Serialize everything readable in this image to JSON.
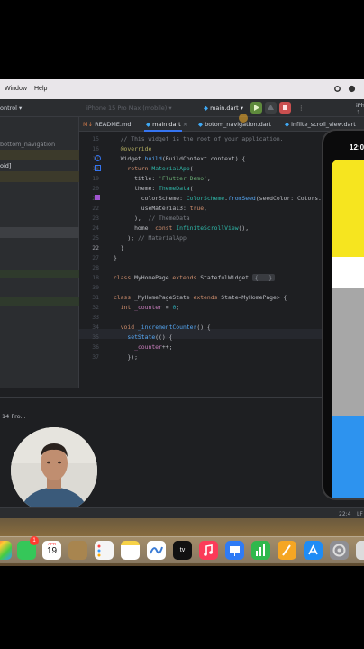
{
  "menubar": {
    "window_label": "Window",
    "help_label": "Help"
  },
  "toolbar": {
    "vcs_label": "ontrol ▾",
    "device_label": "iPhone 15 Pro Max (mobile) ▾",
    "run_config_label": "main.dart ▾",
    "device_short": "iPh",
    "device_short2": "1"
  },
  "tabs": [
    {
      "label": "README.md",
      "active": false
    },
    {
      "label": "main.dart",
      "active": true
    },
    {
      "label": "botom_navigation.dart",
      "active": false
    },
    {
      "label": "infilte_scroll_view.dart",
      "active": false
    }
  ],
  "project_panel": {
    "item1": "bottom_navigation",
    "item2": "oid]"
  },
  "editor": {
    "lines": [
      {
        "n": "15",
        "text": "// This widget is the root of your application."
      },
      {
        "n": "16",
        "text": "@override"
      },
      {
        "n": "17",
        "text": "Widget build(BuildContext context) {"
      },
      {
        "n": "18",
        "text": "return MaterialApp("
      },
      {
        "n": "19",
        "text": "title: 'Flutter Demo',"
      },
      {
        "n": "20",
        "text": "theme: ThemeData("
      },
      {
        "n": "21",
        "text": "colorScheme: ColorScheme.fromSeed(seedColor: Colors.d"
      },
      {
        "n": "22",
        "text": "useMaterial3: true,"
      },
      {
        "n": "23",
        "text": "),  // ThemeData"
      },
      {
        "n": "24",
        "text": "home: const InfiniteScrollView(),"
      },
      {
        "n": "25",
        "text": "); // MaterialApp"
      },
      {
        "n": "22",
        "text": "}"
      },
      {
        "n": "27",
        "text": "}"
      },
      {
        "n": "28",
        "text": ""
      },
      {
        "n": "18",
        "text": "class MyHomePage extends StatefulWidget {...}"
      },
      {
        "n": "30",
        "text": ""
      },
      {
        "n": "31",
        "text": "class _MyHomePageState extends State<MyHomePage> {"
      },
      {
        "n": "32",
        "text": "int _counter = 0;"
      },
      {
        "n": "33",
        "text": ""
      },
      {
        "n": "34",
        "text": "void _incrementCounter() {"
      },
      {
        "n": "35",
        "text": "setState(() {"
      },
      {
        "n": "36",
        "text": "_counter++;"
      },
      {
        "n": "37",
        "text": "});"
      }
    ]
  },
  "run_panel": {
    "label": "14 Pro..."
  },
  "statusbar": {
    "position": "22:4",
    "encoding": "LF"
  },
  "phone": {
    "time": "12:0",
    "blocks": [
      {
        "color": "#f6e51f"
      },
      {
        "color": "#a7a7a7"
      },
      {
        "color": "#2d93ef"
      }
    ]
  },
  "dock": {
    "calendar_month": "APR",
    "calendar_day": "19",
    "badge": "1"
  }
}
